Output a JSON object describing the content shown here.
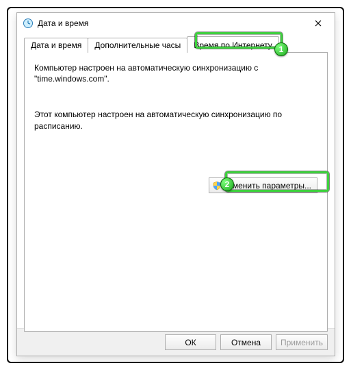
{
  "window": {
    "title": "Дата и время"
  },
  "tabs": {
    "t0": "Дата и время",
    "t1": "Дополнительные часы",
    "t2": "Время по Интернету"
  },
  "panel": {
    "line1": "Компьютер настроен на автоматическую синхронизацию с \"time.windows.com\".",
    "line2": "Этот компьютер настроен на автоматическую синхронизацию по расписанию.",
    "change_btn": "Изменить параметры..."
  },
  "footer": {
    "ok": "ОК",
    "cancel": "Отмена",
    "apply": "Применить"
  },
  "badges": {
    "b1": "1",
    "b2": "2"
  }
}
